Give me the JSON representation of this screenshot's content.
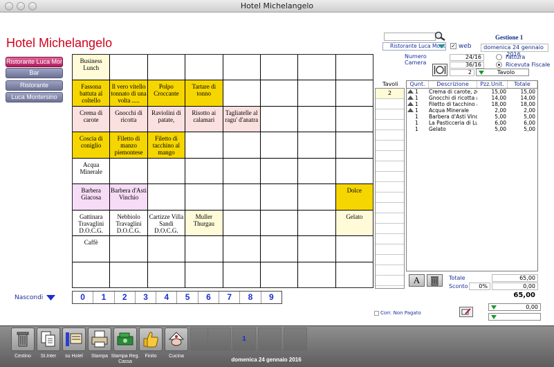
{
  "window": {
    "title": "Hotel Michelangelo"
  },
  "brand": "Hotel Michelangelo",
  "sidebar": {
    "items": [
      {
        "label": "Ristorante Luca Montersino",
        "active": true
      },
      {
        "label": "Bar",
        "active": false
      },
      {
        "label": "Ristorante",
        "active": false
      },
      {
        "label": "Luca Montersino",
        "active": false
      }
    ]
  },
  "colors": {
    "brand_red": "#d0021b",
    "yellow": "#f6d600",
    "cream": "#fffbd8",
    "pink": "#fbe0e0",
    "lilac": "#f6dcf6",
    "accent_blue": "#1a2fd0"
  },
  "grid": {
    "cells": [
      {
        "row": 0,
        "col": 0,
        "text": "Business Lunch",
        "color": "cream"
      },
      {
        "row": 1,
        "col": 0,
        "text": "Fassona battuta al coltello",
        "color": "yellow"
      },
      {
        "row": 1,
        "col": 1,
        "text": "Il vero vitello tonnato di una volta .....",
        "color": "yellow"
      },
      {
        "row": 1,
        "col": 2,
        "text": "Polpo Croccante",
        "color": "yellow"
      },
      {
        "row": 1,
        "col": 3,
        "text": "Tartare di tonno",
        "color": "yellow"
      },
      {
        "row": 2,
        "col": 0,
        "text": "Crema di carote",
        "color": "pink"
      },
      {
        "row": 2,
        "col": 1,
        "text": "Gnocchi di ricotta",
        "color": "pink"
      },
      {
        "row": 2,
        "col": 2,
        "text": "Raviolini di patate,",
        "color": "pink"
      },
      {
        "row": 2,
        "col": 3,
        "text": "Risotto ai calamari",
        "color": "pink"
      },
      {
        "row": 2,
        "col": 4,
        "text": "Tagliatelle al ragu' d'anatra",
        "color": "pink"
      },
      {
        "row": 3,
        "col": 0,
        "text": "Coscia di coniglio",
        "color": "yellow"
      },
      {
        "row": 3,
        "col": 1,
        "text": "Filetto di manzo piemontese",
        "color": "yellow"
      },
      {
        "row": 3,
        "col": 2,
        "text": "Filetto di tacchino al mango",
        "color": "yellow"
      },
      {
        "row": 4,
        "col": 0,
        "text": "Acqua Minerale",
        "color": "white"
      },
      {
        "row": 5,
        "col": 0,
        "text": "Barbera Giacosa",
        "color": "lilac"
      },
      {
        "row": 5,
        "col": 1,
        "text": "Barbera d'Asti Vinchio",
        "color": "lilac"
      },
      {
        "row": 5,
        "col": 7,
        "text": "Dolce",
        "color": "yellow"
      },
      {
        "row": 6,
        "col": 0,
        "text": "Gattinara Travaglini D.O.C.G.",
        "color": "white"
      },
      {
        "row": 6,
        "col": 1,
        "text": "Nebbiolo Travaglini D.O.C.G.",
        "color": "white"
      },
      {
        "row": 6,
        "col": 2,
        "text": "Cartizze Villa Sandi D.O.C.G.",
        "color": "white"
      },
      {
        "row": 6,
        "col": 3,
        "text": "Muller Thurgau",
        "color": "cream"
      },
      {
        "row": 6,
        "col": 7,
        "text": "Gelato",
        "color": "cream"
      },
      {
        "row": 7,
        "col": 0,
        "text": "Caffè",
        "color": "white"
      }
    ]
  },
  "nascondi": "Nascondi",
  "numbers": [
    "0",
    "1",
    "2",
    "3",
    "4",
    "5",
    "6",
    "7",
    "8",
    "9"
  ],
  "header": {
    "gestione": "Gestione 1",
    "web": "web",
    "date": "domenica 24 gennaio 2016",
    "restaurant_select": "Ristorante Luca Montersino",
    "numero_label": "Numero",
    "numero_value": "24/16",
    "camera_label": "Camera",
    "camera_value": "36/16",
    "fattura": "Fattura",
    "ricevuta": "Ricevuta Fiscale",
    "tavolo_num": "2",
    "tavolo_label": "Tavolo"
  },
  "tavoli": {
    "header": "Tavoli",
    "selected": "2"
  },
  "order": {
    "columns": [
      "Qunt.",
      "Descrizione",
      "Pzz.Unit.",
      "Totale"
    ],
    "rows": [
      {
        "qty": "1",
        "desc": "Crema di carote, ze...",
        "unit": "15,00",
        "total": "15,00",
        "sent": true
      },
      {
        "qty": "1",
        "desc": "Gnocchi di ricotta al...",
        "unit": "14,00",
        "total": "14,00",
        "sent": true
      },
      {
        "qty": "1",
        "desc": "Filetto di tacchino a...",
        "unit": "18,00",
        "total": "18,00",
        "sent": true
      },
      {
        "qty": "1",
        "desc": "Acqua Minerale",
        "unit": "2,00",
        "total": "2,00",
        "sent": true
      },
      {
        "qty": "1",
        "desc": "Barbera d'Asti Vinc...",
        "unit": "5,00",
        "total": "5,00",
        "sent": false
      },
      {
        "qty": "1",
        "desc": "La Pasticceria di Lu...",
        "unit": "6,00",
        "total": "6,00",
        "sent": false
      },
      {
        "qty": "1",
        "desc": "Gelato",
        "unit": "5,00",
        "total": "5,00",
        "sent": false
      }
    ]
  },
  "totals": {
    "totale_label": "Totale",
    "totale": "65,00",
    "sconto_label": "Sconto",
    "sconto_pct": "0%",
    "sconto_value": "0,00",
    "grand": "65,00",
    "extra": "0,00",
    "corr_label": "Corr. Non Pagato",
    "font_btn": "A"
  },
  "toolbar": {
    "buttons": [
      {
        "label": "Cestino",
        "icon": "trash-icon"
      },
      {
        "label": "St.Inter",
        "icon": "print-interim-icon"
      },
      {
        "label": "su Hotel",
        "icon": "hotel-charge-icon"
      },
      {
        "label": "Stampa",
        "icon": "printer-icon"
      },
      {
        "label": "Stampa Reg. Cassa",
        "icon": "cash-register-icon"
      },
      {
        "label": "Finito",
        "icon": "thumbs-up-icon"
      },
      {
        "label": "Cucina",
        "icon": "kitchen-icon"
      }
    ],
    "page": "1",
    "date": "domenica 24 gennaio 2016"
  }
}
